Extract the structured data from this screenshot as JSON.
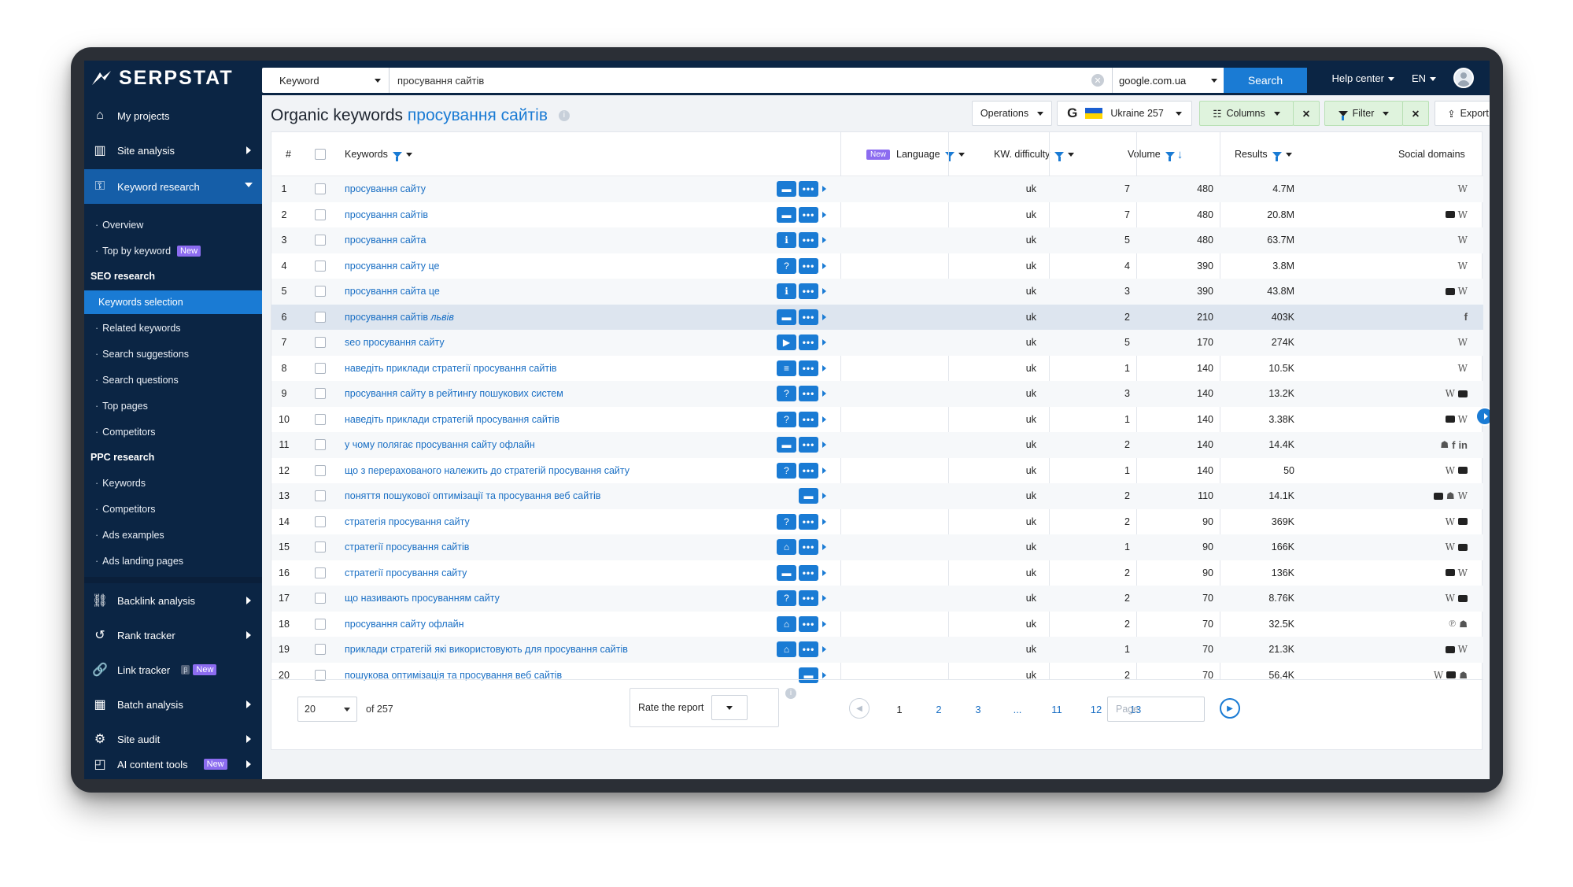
{
  "brand": {
    "name": "SERPSTAT"
  },
  "topbar": {
    "search_type": "Keyword",
    "search_query": "просування сайтів",
    "database": "google.com.ua",
    "search_button": "Search",
    "help": "Help center",
    "lang": "EN"
  },
  "sidebar": {
    "my_projects": "My projects",
    "site_analysis": "Site analysis",
    "keyword_research": "Keyword research",
    "overview": "Overview",
    "top_by_keyword": "Top by keyword",
    "new_badge": "New",
    "seo_research": "SEO research",
    "keywords_selection": "Keywords selection",
    "related_keywords": "Related keywords",
    "search_suggestions": "Search suggestions",
    "search_questions": "Search questions",
    "top_pages": "Top pages",
    "competitors": "Competitors",
    "ppc_research": "PPC research",
    "ppc_keywords": "Keywords",
    "ppc_competitors": "Competitors",
    "ads_examples": "Ads examples",
    "ads_landing_pages": "Ads landing pages",
    "backlink_analysis": "Backlink analysis",
    "rank_tracker": "Rank tracker",
    "link_tracker": "Link tracker",
    "beta_badge": "β",
    "batch_analysis": "Batch analysis",
    "site_audit": "Site audit",
    "ai_content_tools": "AI content tools"
  },
  "header": {
    "title_prefix": "Organic keywords",
    "title_keyword": "просування сайтів",
    "operations": "Operations",
    "region": "Ukraine 257",
    "columns": "Columns",
    "filter": "Filter",
    "export": "Export"
  },
  "table": {
    "columns": {
      "num": "#",
      "keywords": "Keywords",
      "new_badge": "New",
      "language": "Language",
      "kw_difficulty": "KW. difficulty",
      "volume": "Volume",
      "results": "Results",
      "social_domains": "Social domains"
    },
    "rows": [
      {
        "n": "1",
        "kw": "просування сайту",
        "feat": "chat",
        "lang": "uk",
        "kd": "7",
        "vol": "480",
        "res": "4.7M",
        "social": [
          "W"
        ]
      },
      {
        "n": "2",
        "kw": "просування сайтів",
        "feat": "chat",
        "lang": "uk",
        "kd": "7",
        "vol": "480",
        "res": "20.8M",
        "social": [
          "yt",
          "W"
        ]
      },
      {
        "n": "3",
        "kw": "просування сайта",
        "feat": "info",
        "lang": "uk",
        "kd": "5",
        "vol": "480",
        "res": "63.7M",
        "social": [
          "W"
        ]
      },
      {
        "n": "4",
        "kw": "просування сайту це",
        "feat": "q",
        "lang": "uk",
        "kd": "4",
        "vol": "390",
        "res": "3.8M",
        "social": [
          "W"
        ]
      },
      {
        "n": "5",
        "kw": "просування сайта це",
        "feat": "info",
        "lang": "uk",
        "kd": "3",
        "vol": "390",
        "res": "43.8M",
        "social": [
          "yt",
          "W"
        ]
      },
      {
        "n": "6",
        "kw": "просування сайтів",
        "kw_extra": "львів",
        "feat": "chat",
        "lang": "uk",
        "kd": "2",
        "vol": "210",
        "res": "403K",
        "social": [
          "f"
        ]
      },
      {
        "n": "7",
        "kw": "seo просування сайту",
        "feat": "video",
        "lang": "uk",
        "kd": "5",
        "vol": "170",
        "res": "274K",
        "social": [
          "W"
        ]
      },
      {
        "n": "8",
        "kw": "наведіть приклади стратегії просування сайтів",
        "feat": "list",
        "lang": "uk",
        "kd": "1",
        "vol": "140",
        "res": "10.5K",
        "social": [
          "W"
        ]
      },
      {
        "n": "9",
        "kw": "просування сайту в рейтингу пошукових систем",
        "feat": "q",
        "lang": "uk",
        "kd": "3",
        "vol": "140",
        "res": "13.2K",
        "social": [
          "W",
          "yt"
        ]
      },
      {
        "n": "10",
        "kw": "наведіть приклади стратегій просування сайтів",
        "feat": "q",
        "lang": "uk",
        "kd": "1",
        "vol": "140",
        "res": "3.38K",
        "social": [
          "yt",
          "W"
        ]
      },
      {
        "n": "11",
        "kw": "у чому полягає просування сайту офлайн",
        "feat": "chat",
        "lang": "uk",
        "kd": "2",
        "vol": "140",
        "res": "14.4K",
        "social": [
          "rd",
          "f",
          "in"
        ]
      },
      {
        "n": "12",
        "kw": "що з перерахованого належить до стратегій просування сайту",
        "feat": "q",
        "lang": "uk",
        "kd": "1",
        "vol": "140",
        "res": "50",
        "social": [
          "W",
          "yt"
        ]
      },
      {
        "n": "13",
        "kw": "поняття пошукової оптимізації та просування веб сайтів",
        "feat": "chat-only",
        "lang": "uk",
        "kd": "2",
        "vol": "110",
        "res": "14.1K",
        "social": [
          "yt",
          "rd",
          "W"
        ]
      },
      {
        "n": "14",
        "kw": "стратегія просування сайту",
        "feat": "q",
        "lang": "uk",
        "kd": "2",
        "vol": "90",
        "res": "369K",
        "social": [
          "W",
          "yt"
        ]
      },
      {
        "n": "15",
        "kw": "стратегії просування сайтів",
        "feat": "shop",
        "lang": "uk",
        "kd": "1",
        "vol": "90",
        "res": "166K",
        "social": [
          "W",
          "yt"
        ]
      },
      {
        "n": "16",
        "kw": "стратегії просування сайту",
        "feat": "chat",
        "lang": "uk",
        "kd": "2",
        "vol": "90",
        "res": "136K",
        "social": [
          "yt",
          "W"
        ]
      },
      {
        "n": "17",
        "kw": "що називають просуванням сайту",
        "feat": "q",
        "lang": "uk",
        "kd": "2",
        "vol": "70",
        "res": "8.76K",
        "social": [
          "W",
          "yt"
        ]
      },
      {
        "n": "18",
        "kw": "просування сайту офлайн",
        "feat": "shop",
        "lang": "uk",
        "kd": "2",
        "vol": "70",
        "res": "32.5K",
        "social": [
          "pin",
          "rd"
        ]
      },
      {
        "n": "19",
        "kw": "приклади стратегій які використовують для просування сайтів",
        "feat": "shop",
        "lang": "uk",
        "kd": "1",
        "vol": "70",
        "res": "21.3K",
        "social": [
          "yt",
          "W"
        ]
      },
      {
        "n": "20",
        "kw": "пошукова оптимізація та просування веб сайтів",
        "feat": "chat-only",
        "lang": "uk",
        "kd": "2",
        "vol": "70",
        "res": "56.4K",
        "social": [
          "W",
          "yt",
          "rd"
        ]
      }
    ]
  },
  "pager": {
    "per_page": "20",
    "of_total": "of 257",
    "rate": "Rate the report",
    "pages": [
      "1",
      "2",
      "3",
      "...",
      "11",
      "12",
      "13"
    ],
    "page_placeholder": "Page"
  },
  "colors": {
    "navy": "#0b2544",
    "accent": "#1a7bd4",
    "active_nav": "#155ea8",
    "new_badge": "#8c6cf0"
  }
}
